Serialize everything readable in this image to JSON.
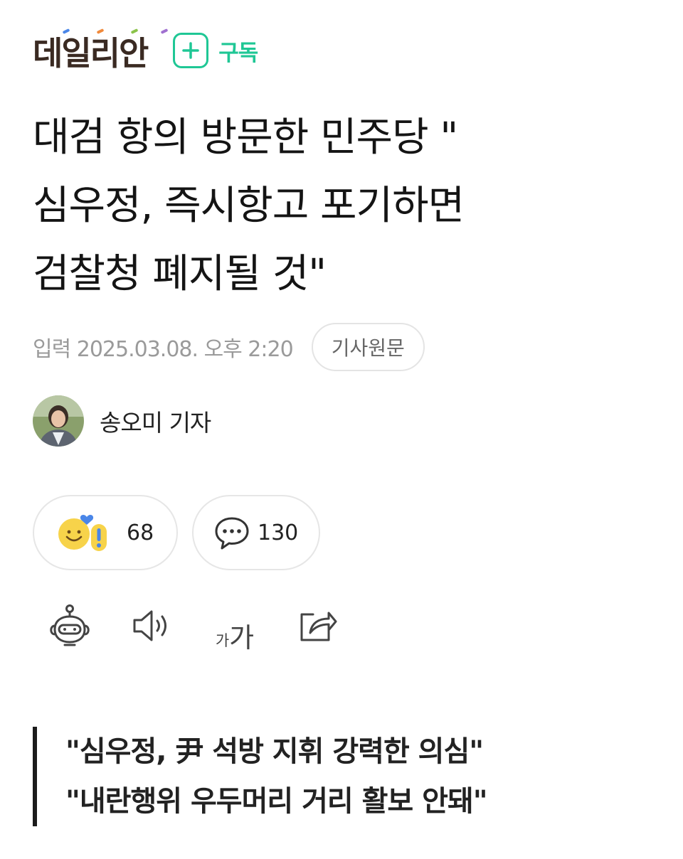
{
  "header": {
    "logo_text": "데일리안",
    "subscribe_label": "구독",
    "colors": {
      "logo": "#3a2a22",
      "subscribe": "#1fc795",
      "logo_dots": [
        "#4a86e8",
        "#f08a3c",
        "#8bc34a",
        "#a070d0"
      ]
    },
    "subscribe_icon": "plus-icon"
  },
  "article": {
    "headline_lines": [
      "대검 항의 방문한 민주당 \"",
      "심우정, 즉시항고 포기하면",
      "검찰청 폐지될 것\""
    ],
    "published": "입력 2025.03.08. 오후 2:20",
    "source_button": "기사원문",
    "author": {
      "name": "송오미 기자",
      "avatar_icon": "author-photo"
    },
    "subheads": [
      "\"심우정, 尹 석방 지휘 강력한 의심\"",
      "\"내란행위 우두머리 거리 활보 안돼\""
    ]
  },
  "reactions": {
    "reaction_icon": "emoji-reaction-icon",
    "reaction_count": "68",
    "comment_icon": "comment-bubble-icon",
    "comment_count": "130"
  },
  "toolbar": {
    "items": [
      "robot-summary-icon",
      "speaker-icon",
      "font-size-icon",
      "share-icon"
    ],
    "font_small": "가",
    "font_large": "가"
  }
}
